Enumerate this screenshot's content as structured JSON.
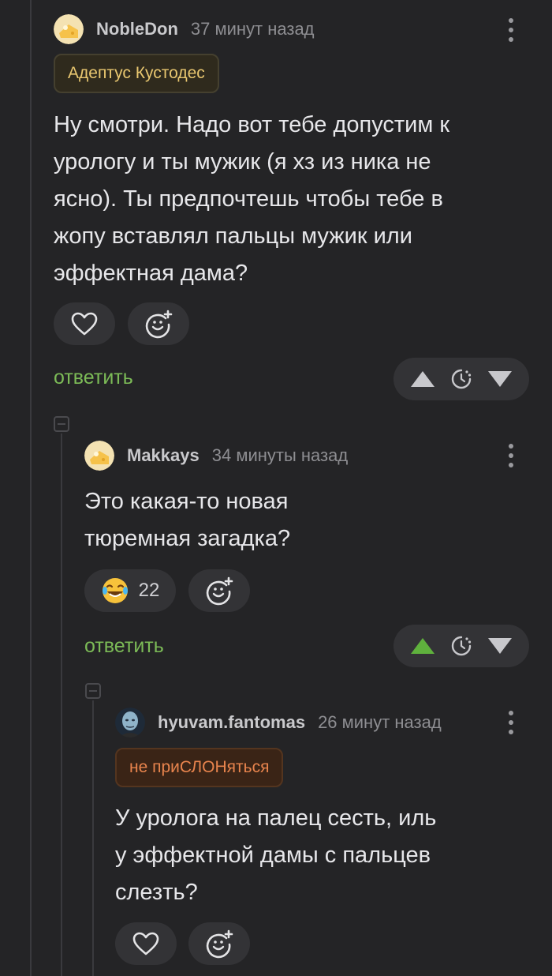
{
  "comments": [
    {
      "username": "NobleDon",
      "timestamp": "37 минут назад",
      "badge": "Адептус Кустодес",
      "text": "Ну смотри. Надо вот тебе допустим к урологу и ты мужик (я хз из ника не ясно). Ты предпочтешь чтобы тебе в жопу вставлял пальцы мужик или эффектная дама?",
      "reply_label": "ответить",
      "upvoted": false
    },
    {
      "username": "Makkays",
      "timestamp": "34 минуты назад",
      "text": "Это какая-то новая тюремная загадка?",
      "reaction_count": "22",
      "reply_label": "ответить",
      "upvoted": true
    },
    {
      "username": "hyuvam.fantomas",
      "timestamp": "26 минут назад",
      "badge": "не приСЛОНяться",
      "text": "У уролога на палец сесть, иль у эффектной дамы с пальцев слезть?"
    }
  ],
  "colors": {
    "background": "#242426",
    "reply_green": "#7cbb57",
    "upvote_active": "#5fb13d",
    "badge_gold": "#e9c770",
    "badge_orange": "#e8844d"
  },
  "icons": [
    "heart-icon",
    "add-reaction-icon",
    "upvote-icon",
    "downvote-icon",
    "vote-timer-icon",
    "more-options-icon",
    "laughing-emoji-icon"
  ]
}
